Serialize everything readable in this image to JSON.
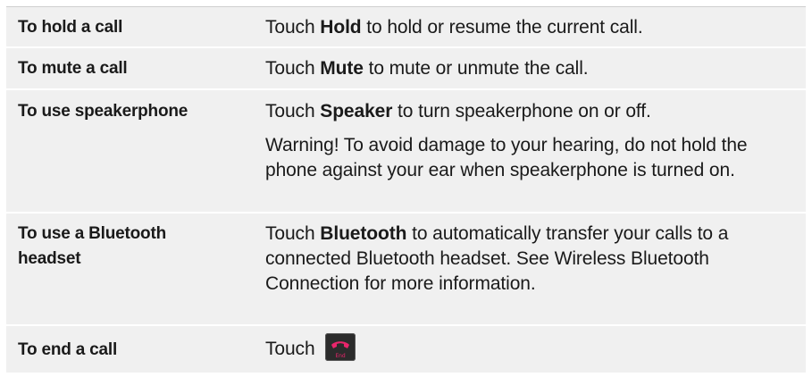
{
  "rows": [
    {
      "label": "To hold a call",
      "desc_pre": "Touch ",
      "desc_bold": "Hold",
      "desc_post": " to hold or resume the current call."
    },
    {
      "label": "To mute a call",
      "desc_pre": "Touch ",
      "desc_bold": "Mute",
      "desc_post": " to mute or unmute the call."
    },
    {
      "label": "To use speakerphone",
      "desc_pre": "Touch ",
      "desc_bold": "Speaker",
      "desc_post": " to turn speakerphone on or off.",
      "warning": "Warning! To avoid damage to your hearing, do not hold the phone against your ear when speakerphone is turned on."
    },
    {
      "label": "To use a Bluetooth headset",
      "desc_pre": "Touch ",
      "desc_bold": "Bluetooth",
      "desc_post": " to automatically transfer your calls to a connected Bluetooth headset. See Wireless Bluetooth Connection for more information."
    },
    {
      "label": "To end a call",
      "desc_pre": "Touch ",
      "icon": "end-call-icon",
      "icon_text": "End",
      "icon_color": "#e8256b"
    }
  ]
}
